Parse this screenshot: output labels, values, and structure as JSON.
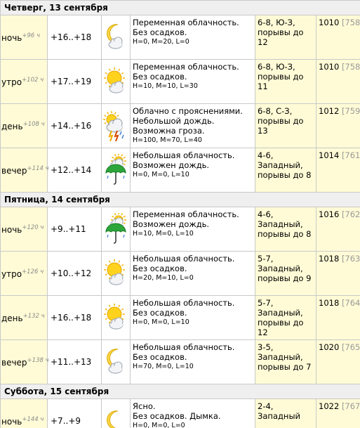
{
  "days": [
    {
      "header": "Четверг, 13 сентября",
      "rows": [
        {
          "tod": "ночь",
          "offset": "+96 ч",
          "temp": "+16..+18",
          "icon": "moon-cloud-icon",
          "desc1": "Переменная облачность.",
          "desc2": "Без осадков.",
          "hml": "H=0, M=20, L=0",
          "wind": "6-8, Ю-З, порывы до 12",
          "pressure": "1010",
          "pressure_idx": "[758]"
        },
        {
          "tod": "утро",
          "offset": "+102 ч",
          "temp": "+17..+19",
          "icon": "sun-cloud-icon",
          "desc1": "Переменная облачность.",
          "desc2": "Без осадков.",
          "hml": "H=10, M=10, L=30",
          "wind": "6-8, Ю-З, порывы до 11",
          "pressure": "1010",
          "pressure_idx": "[758]"
        },
        {
          "tod": "день",
          "offset": "+108 ч",
          "temp": "+14..+16",
          "icon": "thunderstorm-rain-icon",
          "desc1": "Облачно с прояснениями.",
          "desc2": "Небольшой дождь. Возможна гроза.",
          "hml": "H=100, M=70, L=40",
          "wind": "6-8, С-З, порывы до 13",
          "pressure": "1012",
          "pressure_idx": "[759]"
        },
        {
          "tod": "вечер",
          "offset": "+114 ч",
          "temp": "+12..+14",
          "icon": "umbrella-rain-icon",
          "desc1": "Небольшая облачность.",
          "desc2": "Возможен дождь.",
          "hml": "H=0, M=0, L=10",
          "wind": "4-6, Западный, порывы до 8",
          "pressure": "1014",
          "pressure_idx": "[761]"
        }
      ]
    },
    {
      "header": "Пятница, 14 сентября",
      "rows": [
        {
          "tod": "ночь",
          "offset": "+120 ч",
          "temp": "+9..+11",
          "icon": "umbrella-rain-icon",
          "desc1": "Переменная облачность.",
          "desc2": "Возможен дождь.",
          "hml": "H=10, M=0, L=10",
          "wind": "4-6, Западный, порывы до 8",
          "pressure": "1016",
          "pressure_idx": "[762]"
        },
        {
          "tod": "утро",
          "offset": "+126 ч",
          "temp": "+10..+12",
          "icon": "sun-cloud-icon",
          "desc1": "Небольшая облачность.",
          "desc2": "Без осадков.",
          "hml": "H=20, M=10, L=0",
          "wind": "5-7, Западный, порывы до 9",
          "pressure": "1018",
          "pressure_idx": "[763]"
        },
        {
          "tod": "день",
          "offset": "+132 ч",
          "temp": "+16..+18",
          "icon": "sun-cloud-icon",
          "desc1": "Небольшая облачность.",
          "desc2": "Без осадков.",
          "hml": "H=0, M=0, L=10",
          "wind": "5-7, Западный, порывы до 12",
          "pressure": "1018",
          "pressure_idx": "[764]"
        },
        {
          "tod": "вечер",
          "offset": "+138 ч",
          "temp": "+11..+13",
          "icon": "moon-cloud-icon",
          "desc1": "Небольшая облачность.",
          "desc2": "Без осадков.",
          "hml": "H=70, M=0, L=10",
          "wind": "3-5, Западный, порывы до 7",
          "pressure": "1020",
          "pressure_idx": "[765]"
        }
      ]
    },
    {
      "header": "Суббота, 15 сентября",
      "rows": [
        {
          "tod": "ночь",
          "offset": "+144 ч",
          "temp": "+7..+9",
          "icon": "moon-icon",
          "desc1": "Ясно.",
          "desc2": "Без осадков. Дымка.",
          "hml": "H=0, M=0, L=0",
          "wind": "2-4, Западный",
          "pressure": "1022",
          "pressure_idx": "[767]"
        }
      ]
    }
  ]
}
